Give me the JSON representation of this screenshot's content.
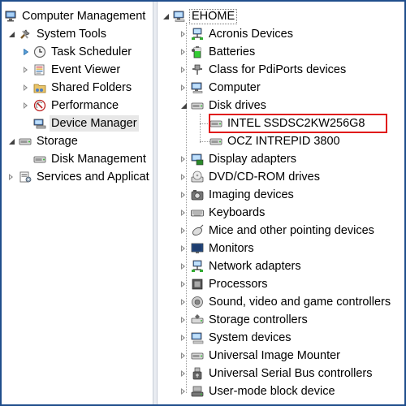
{
  "left_tree": {
    "root": "Computer Management",
    "system_tools": "System Tools",
    "task_scheduler": "Task Scheduler",
    "event_viewer": "Event Viewer",
    "shared_folders": "Shared Folders",
    "performance": "Performance",
    "device_manager": "Device Manager",
    "storage": "Storage",
    "disk_management": "Disk Management",
    "services": "Services and Applicat"
  },
  "right_tree": {
    "root": "EHOME",
    "categories": [
      "Acronis Devices",
      "Batteries",
      "Class for PdiPorts devices",
      "Computer",
      "Disk drives",
      "Display adapters",
      "DVD/CD-ROM drives",
      "Imaging devices",
      "Keyboards",
      "Mice and other pointing devices",
      "Monitors",
      "Network adapters",
      "Processors",
      "Sound, video and game controllers",
      "Storage controllers",
      "System devices",
      "Universal Image Mounter",
      "Universal Serial Bus controllers",
      "User-mode block device"
    ],
    "disk_drives": [
      "INTEL SSDSC2KW256G8",
      "OCZ INTREPID 3800"
    ]
  },
  "icons": {
    "computer_management": "computer-management-icon",
    "tools": "tools-icon",
    "clock": "clock-icon",
    "event": "event-viewer-icon",
    "shared": "shared-folder-icon",
    "performance": "performance-icon",
    "device_manager": "device-manager-icon",
    "storage": "storage-icon",
    "disk": "disk-icon",
    "services": "services-icon"
  },
  "colors": {
    "highlight_border": "#e01b1b",
    "frame_border": "#1f4e8c",
    "selected_bg": "#e7e7e7"
  }
}
